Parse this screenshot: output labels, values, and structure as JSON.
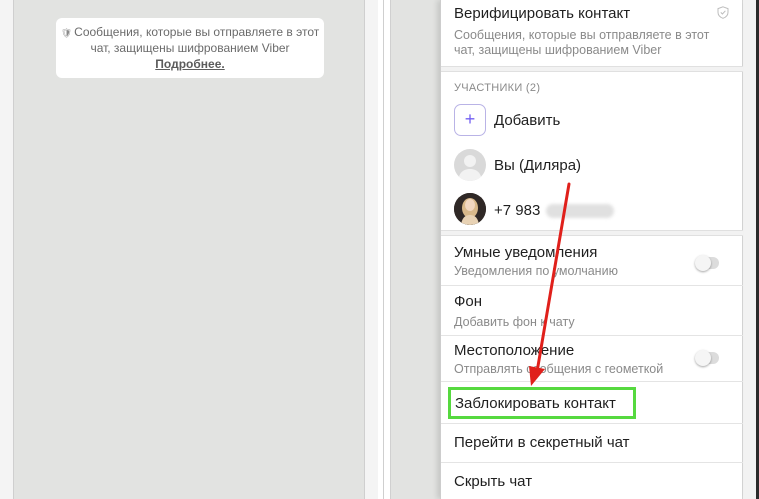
{
  "left_chat": {
    "encryption_text": "Сообщения, которые вы отправляете в этот чат, защищены шифрованием Viber",
    "learn_more": "Подробнее."
  },
  "panel": {
    "verify": {
      "title": "Верифицировать контакт",
      "subtitle_line1": "Сообщения, которые вы отправляете в этот",
      "subtitle_line2": "чат, защищены шифрованием Viber"
    },
    "participants_label": "УЧАСТНИКИ (2)",
    "add_label": "Добавить",
    "me_label": "Вы (Диляра)",
    "contact_phone": "+7 983",
    "smart_notifications": {
      "title": "Умные уведомления",
      "subtitle": "Уведомления по умолчанию",
      "enabled": false
    },
    "background": {
      "title": "Фон",
      "subtitle": "Добавить фон к чату"
    },
    "location": {
      "title": "Местоположение",
      "subtitle": "Отправлять сообщения с геометкой",
      "enabled": false
    },
    "block_contact": "Заблокировать контакт",
    "secret_chat": "Перейти в секретный чат",
    "hide_chat": "Скрыть чат"
  },
  "colors": {
    "highlight_box": "#56d93f",
    "annotation_arrow": "#e0201b",
    "viber_purple": "#7360f2"
  }
}
